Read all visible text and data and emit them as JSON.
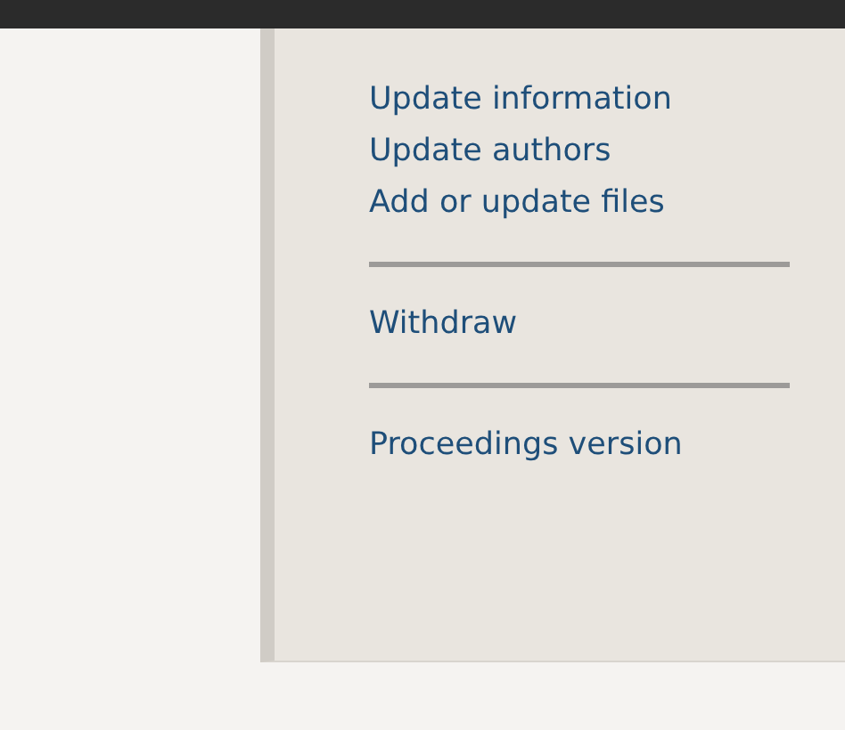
{
  "menu": {
    "groups": [
      {
        "links": [
          "Update information",
          "Update authors",
          "Add or update files"
        ]
      },
      {
        "links": [
          "Withdraw"
        ]
      },
      {
        "links": [
          "Proceedings version"
        ]
      }
    ]
  }
}
